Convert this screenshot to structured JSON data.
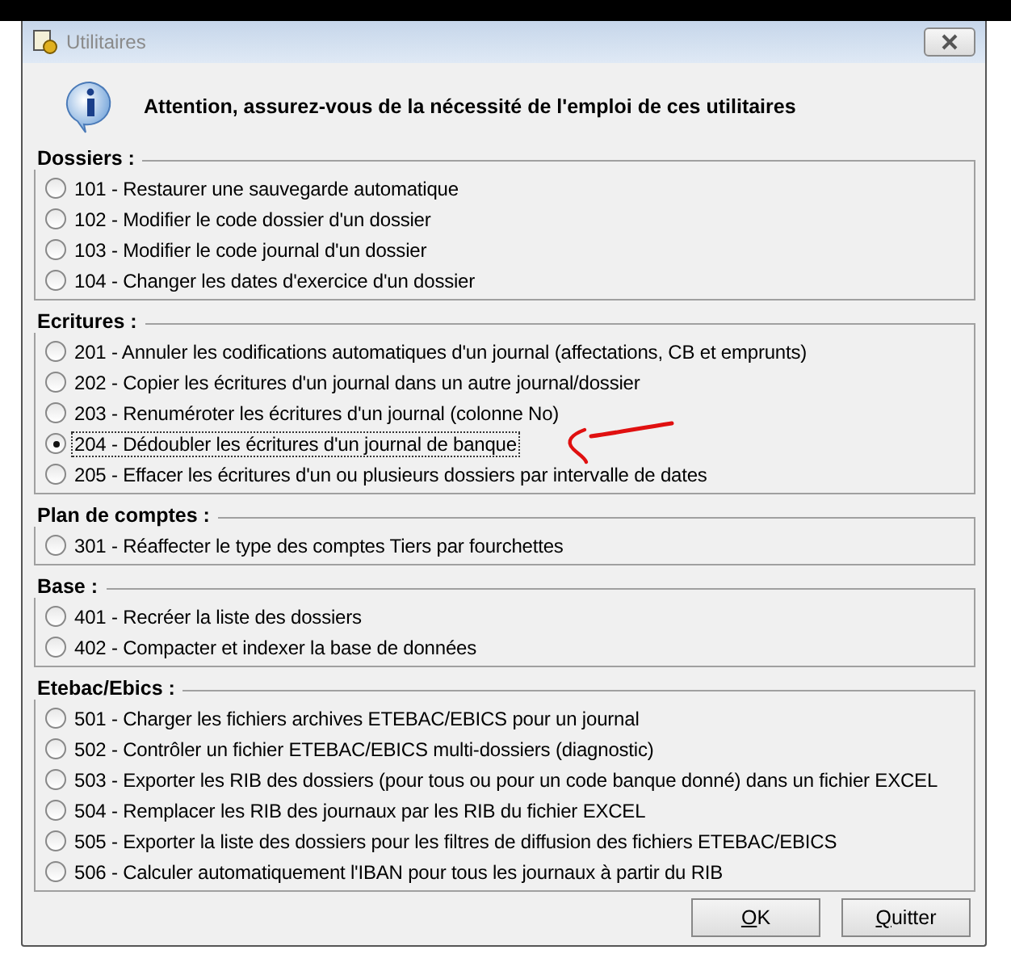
{
  "window": {
    "title": "Utilitaires"
  },
  "message": "Attention, assurez-vous de la nécessité de l'emploi de ces utilitaires",
  "groups": [
    {
      "title": "Dossiers :",
      "options": [
        {
          "label": "101 - Restaurer une sauvegarde automatique",
          "selected": false
        },
        {
          "label": "102 - Modifier le code dossier d'un dossier",
          "selected": false
        },
        {
          "label": "103 - Modifier le code journal d'un dossier",
          "selected": false
        },
        {
          "label": "104 - Changer les dates d'exercice d'un dossier",
          "selected": false
        }
      ]
    },
    {
      "title": "Ecritures :",
      "options": [
        {
          "label": "201 - Annuler les codifications automatiques d'un journal (affectations, CB et emprunts)",
          "selected": false
        },
        {
          "label": "202 - Copier les écritures d'un journal dans un autre journal/dossier",
          "selected": false
        },
        {
          "label": "203 - Renuméroter les écritures d'un journal (colonne No)",
          "selected": false
        },
        {
          "label": "204 - Dédoubler les écritures d'un journal de banque",
          "selected": true
        },
        {
          "label": "205 - Effacer les écritures d'un ou plusieurs dossiers par intervalle de dates",
          "selected": false
        }
      ]
    },
    {
      "title": "Plan de comptes :",
      "options": [
        {
          "label": "301 - Réaffecter le type des comptes Tiers par fourchettes",
          "selected": false
        }
      ]
    },
    {
      "title": "Base :",
      "options": [
        {
          "label": "401 - Recréer la liste des dossiers",
          "selected": false
        },
        {
          "label": "402 - Compacter et indexer la base de données",
          "selected": false
        }
      ]
    },
    {
      "title": "Etebac/Ebics :",
      "options": [
        {
          "label": "501 - Charger les fichiers archives ETEBAC/EBICS pour un journal",
          "selected": false
        },
        {
          "label": "502 - Contrôler un fichier ETEBAC/EBICS multi-dossiers (diagnostic)",
          "selected": false
        },
        {
          "label": "503 - Exporter les RIB des dossiers (pour tous ou pour un code banque donné) dans un fichier EXCEL",
          "selected": false
        },
        {
          "label": "504 - Remplacer les RIB des journaux par les RIB du fichier EXCEL",
          "selected": false
        },
        {
          "label": "505 - Exporter la liste des dossiers pour les filtres de diffusion des fichiers ETEBAC/EBICS",
          "selected": false
        },
        {
          "label": "506 - Calculer automatiquement l'IBAN pour tous les journaux à partir du RIB",
          "selected": false
        }
      ]
    }
  ],
  "buttons": [
    {
      "key": "O",
      "rest": "K"
    },
    {
      "key": "Q",
      "rest": "uitter"
    }
  ]
}
